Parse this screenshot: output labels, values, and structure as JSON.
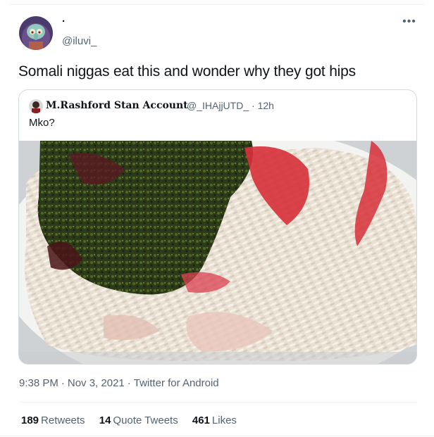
{
  "tweet": {
    "display_name": ".",
    "handle": "@iluvi_",
    "more_icon": "more-horizontal-icon",
    "text": "Somali niggas eat this and wonder why they got hips"
  },
  "quote": {
    "display_name": "M.Rashford Stan Account",
    "handle": "@_IHAjjUTD_",
    "dot": "·",
    "time": "12h",
    "text": "Mko?",
    "media": "food-photo"
  },
  "meta": {
    "time": "9:38 PM",
    "date": "Nov 3, 2021",
    "source": "Twitter for Android",
    "sep": "·"
  },
  "stats": {
    "retweets_count": "189",
    "retweets_label": "Retweets",
    "quotes_count": "14",
    "quotes_label": "Quote Tweets",
    "likes_count": "461",
    "likes_label": "Likes"
  },
  "colors": {
    "text_primary": "#0f1419",
    "text_secondary": "#536471",
    "border": "#cfd9de"
  }
}
